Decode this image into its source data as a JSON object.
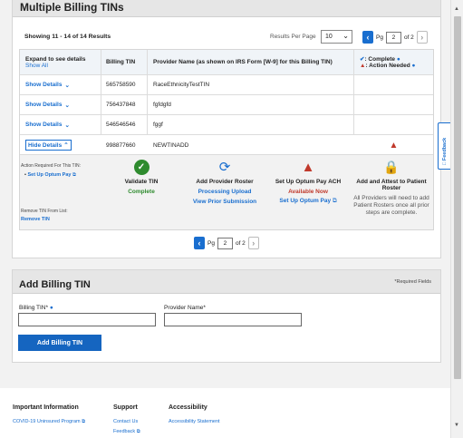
{
  "section_title": "Multiple Billing TINs",
  "showing_text": "Showing 11 - 14 of 14 Results",
  "results_per_page_label": "Results Per Page",
  "results_per_page_value": "10",
  "pagination": {
    "pg_label": "Pg",
    "current": "2",
    "of_label": "of 2"
  },
  "columns": {
    "expand": "Expand to see details",
    "show_all": "Show All",
    "tin": "Billing TIN",
    "provider": "Provider Name (as shown on IRS Form [W-9] for this Billing TIN)",
    "complete_legend": ": Complete",
    "action_legend": ": Action Needed"
  },
  "rows": [
    {
      "toggle": "Show Details",
      "tin": "565758590",
      "name": "RaceEthnicityTestTIN"
    },
    {
      "toggle": "Show Details",
      "tin": "756437848",
      "name": "fgfdgfd"
    },
    {
      "toggle": "Show Details",
      "tin": "546546546",
      "name": "fggf"
    },
    {
      "toggle": "Hide Details",
      "tin": "998877660",
      "name": "NEWTINADD"
    }
  ],
  "details": {
    "action_required_label": "Action Required For This TIN:",
    "action_link": "Set Up Optum Pay",
    "remove_label": "Remove TIN From List:",
    "remove_link": "Remove TIN",
    "steps": [
      {
        "title": "Validate TIN",
        "status": "Complete"
      },
      {
        "title": "Add Provider Roster",
        "status": "Processing Upload",
        "link": "View Prior Submission"
      },
      {
        "title": "Set Up Optum Pay ACH",
        "status": "Available Now",
        "link": "Set Up Optum Pay"
      },
      {
        "title": "Add and Attest to Patient Roster",
        "note": "All Providers will need to add Patient Rosters once all prior steps are complete."
      }
    ]
  },
  "add_form": {
    "title": "Add Billing TIN",
    "required_note": "*Required Fields",
    "tin_label": "Billing TIN*",
    "provider_label": "Provider Name*",
    "button": "Add Billing TIN"
  },
  "feedback_tab": "Feedback",
  "footer": {
    "col1_title": "Important Information",
    "col1_link": "COVID-19 Uninsured Program",
    "col2_title": "Support",
    "col2_link": "Contact Us",
    "col2_link2": "Feedback",
    "col3_title": "Accessibility",
    "col3_link": "Accessibility Statement"
  },
  "colors": {
    "accent": "#196ecf",
    "success": "#2e8b2e",
    "warning": "#c0392b",
    "button": "#1565c0"
  }
}
